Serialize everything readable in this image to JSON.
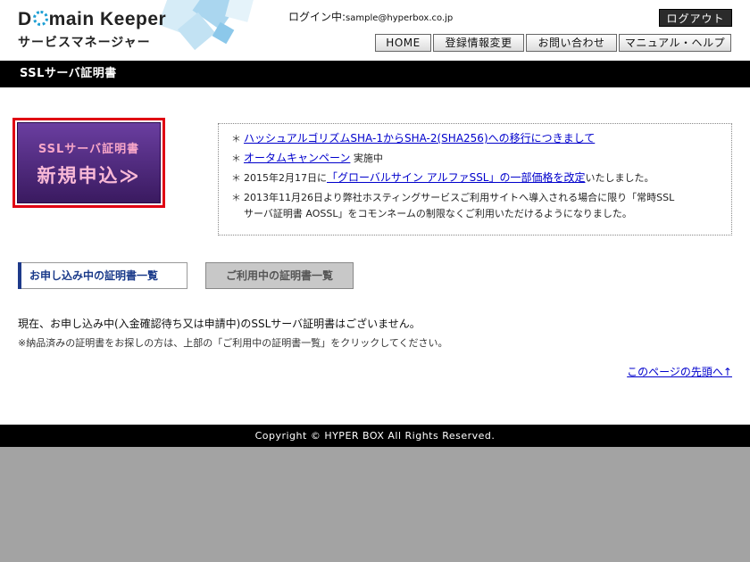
{
  "header": {
    "logo_pre": "D",
    "logo_post": "main Keeper",
    "logo_sub": "サービスマネージャー",
    "login_label": "ログイン中:",
    "login_email": "sample@hyperbox.co.jp",
    "logout_label": "ログアウト",
    "nav": [
      "HOME",
      "登録情報変更",
      "お問い合わせ",
      "マニュアル・ヘルプ"
    ]
  },
  "page_title": "SSLサーバ証明書",
  "promo": {
    "small": "SSLサーバ証明書",
    "big": "新規申込≫"
  },
  "notices": {
    "star": "＊",
    "n1_link": "ハッシュアルゴリズムSHA-1からSHA-2(SHA256)への移行につきまして",
    "n2_link": "オータムキャンペーン",
    "n2_text": " 実施中",
    "n3_pre": "2015年2月17日に",
    "n3_link": "「グローバルサイン アルファSSL」の一部価格を改定",
    "n3_post": "いたしました。",
    "n4_line1": "2013年11月26日より弊社ホスティングサービスご利用サイトへ導入される場合に限り「常時SSL",
    "n4_line2": "サーバ証明書 AOSSL」をコモンネームの制限なくご利用いただけるようになりました。"
  },
  "tabs": {
    "active": "お申し込み中の証明書一覧",
    "inactive": "ご利用中の証明書一覧"
  },
  "message": {
    "line1": "現在、お申し込み中(入金確認待ち又は申請中)のSSLサーバ証明書はございません。",
    "line2": "※納品済みの証明書をお探しの方は、上部の「ご利用中の証明書一覧」をクリックしてください。",
    "pagetop": "このページの先頭へ↑"
  },
  "footer": {
    "copyright": "Copyright © HYPER BOX All Rights Reserved."
  },
  "colors": {
    "accent_red": "#e00012",
    "promo_purple": "#4a2a7a",
    "link_blue": "#0000cc",
    "logo_blue": "#1e9fd4"
  }
}
